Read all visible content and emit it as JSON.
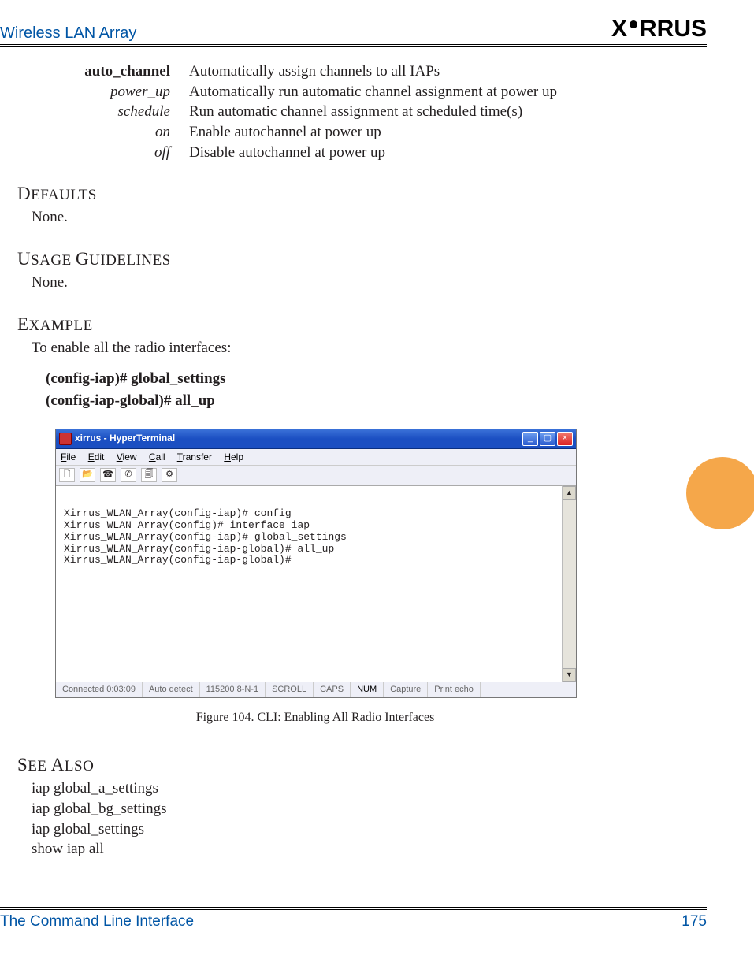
{
  "header": {
    "title": "Wireless LAN Array",
    "brand": "XIRRUS"
  },
  "params": [
    {
      "label": "auto_channel",
      "style": "bold",
      "desc": "Automatically assign channels to all IAPs"
    },
    {
      "label": "power_up",
      "style": "italic",
      "desc": "Automatically run automatic channel assignment at power up"
    },
    {
      "label": "schedule",
      "style": "italic",
      "desc": "Run automatic channel assignment at scheduled time(s)"
    },
    {
      "label": "on",
      "style": "italic",
      "desc": "Enable autochannel at power up"
    },
    {
      "label": "off",
      "style": "italic",
      "desc": "Disable autochannel at power up"
    }
  ],
  "sections": {
    "defaults": {
      "heading_first": "D",
      "heading_rest": "EFAULTS",
      "body": "None."
    },
    "usage": {
      "heading_first": "U",
      "heading_rest": "SAGE ",
      "heading_first2": "G",
      "heading_rest2": "UIDELINES",
      "body": "None."
    },
    "example": {
      "heading_first": "E",
      "heading_rest": "XAMPLE",
      "intro": "To enable all the radio interfaces:",
      "cmd1": "(config-iap)# global_settings",
      "cmd2": "(config-iap-global)# all_up"
    },
    "seealso": {
      "heading_first": "S",
      "heading_rest": "EE ",
      "heading_first2": "A",
      "heading_rest2": "LSO",
      "items": [
        "iap global_a_settings",
        "iap global_bg_settings",
        "iap global_settings",
        "show iap all"
      ]
    }
  },
  "figure": {
    "caption": "Figure 104. CLI: Enabling All Radio Interfaces",
    "titlebar": "xirrus - HyperTerminal",
    "menus": [
      "File",
      "Edit",
      "View",
      "Call",
      "Transfer",
      "Help"
    ],
    "terminal_lines": [
      "Xirrus_WLAN_Array(config-iap)# config",
      "Xirrus_WLAN_Array(config)# interface iap",
      "Xirrus_WLAN_Array(config-iap)# global_settings",
      "Xirrus_WLAN_Array(config-iap-global)# all_up",
      "Xirrus_WLAN_Array(config-iap-global)#"
    ],
    "status": {
      "connected": "Connected 0:03:09",
      "detect": "Auto detect",
      "baud": "115200 8-N-1",
      "scroll": "SCROLL",
      "caps": "CAPS",
      "num": "NUM",
      "capture": "Capture",
      "print": "Print echo"
    }
  },
  "footer": {
    "section": "The Command Line Interface",
    "page": "175"
  }
}
